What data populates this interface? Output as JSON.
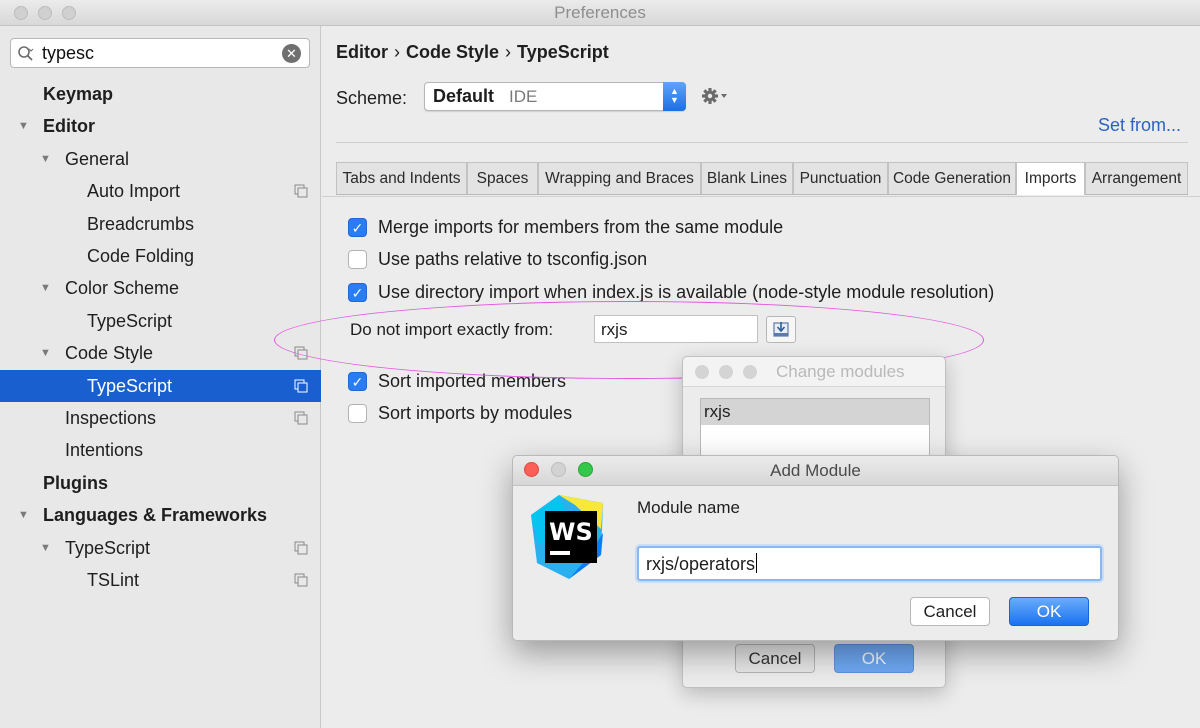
{
  "window": {
    "title": "Preferences"
  },
  "sidebar": {
    "search_value": "typesc",
    "items": [
      {
        "label": "Keymap",
        "level": 0,
        "expandable": false,
        "bold": true,
        "project": false,
        "selected": false
      },
      {
        "label": "Editor",
        "level": 0,
        "expandable": true,
        "bold": true,
        "project": false,
        "selected": false
      },
      {
        "label": "General",
        "level": 1,
        "expandable": true,
        "bold": false,
        "project": false,
        "selected": false
      },
      {
        "label": "Auto Import",
        "level": 2,
        "expandable": false,
        "bold": false,
        "project": true,
        "selected": false
      },
      {
        "label": "Breadcrumbs",
        "level": 2,
        "expandable": false,
        "bold": false,
        "project": false,
        "selected": false
      },
      {
        "label": "Code Folding",
        "level": 2,
        "expandable": false,
        "bold": false,
        "project": false,
        "selected": false
      },
      {
        "label": "Color Scheme",
        "level": 1,
        "expandable": true,
        "bold": false,
        "project": false,
        "selected": false
      },
      {
        "label": "TypeScript",
        "level": 2,
        "expandable": false,
        "bold": false,
        "project": false,
        "selected": false
      },
      {
        "label": "Code Style",
        "level": 1,
        "expandable": true,
        "bold": false,
        "project": true,
        "selected": false
      },
      {
        "label": "TypeScript",
        "level": 2,
        "expandable": false,
        "bold": false,
        "project": true,
        "selected": true
      },
      {
        "label": "Inspections",
        "level": 1,
        "expandable": false,
        "bold": false,
        "project": true,
        "selected": false
      },
      {
        "label": "Intentions",
        "level": 1,
        "expandable": false,
        "bold": false,
        "project": false,
        "selected": false
      },
      {
        "label": "Plugins",
        "level": 0,
        "expandable": false,
        "bold": true,
        "project": false,
        "selected": false
      },
      {
        "label": "Languages & Frameworks",
        "level": 0,
        "expandable": true,
        "bold": true,
        "project": false,
        "selected": false
      },
      {
        "label": "TypeScript",
        "level": 1,
        "expandable": true,
        "bold": false,
        "project": true,
        "selected": false
      },
      {
        "label": "TSLint",
        "level": 2,
        "expandable": false,
        "bold": false,
        "project": true,
        "selected": false
      }
    ]
  },
  "main": {
    "breadcrumb": [
      "Editor",
      "Code Style",
      "TypeScript"
    ],
    "breadcrumb_separator": "›",
    "scheme_label": "Scheme:",
    "scheme_name": "Default",
    "scheme_type": "IDE",
    "set_from": "Set from...",
    "tabs": [
      "Tabs and Indents",
      "Spaces",
      "Wrapping and Braces",
      "Blank Lines",
      "Punctuation",
      "Code Generation",
      "Imports",
      "Arrangement"
    ],
    "active_tab": "Imports",
    "options": [
      {
        "label": "Merge imports for members from the same module",
        "checked": true
      },
      {
        "label": "Use paths relative to tsconfig.json",
        "checked": false
      },
      {
        "label": "Use directory import when index.js is available (node-style module resolution)",
        "checked": true
      },
      {
        "label": "Sort imported members",
        "checked": true
      },
      {
        "label": "Sort imports by modules",
        "checked": false
      }
    ],
    "do_not_import_label": "Do not import exactly from:",
    "do_not_import_value": "rxjs"
  },
  "change_modules_dialog": {
    "title": "Change modules",
    "items": [
      "rxjs"
    ],
    "cancel_label": "Cancel",
    "ok_label": "OK"
  },
  "add_module_dialog": {
    "title": "Add Module",
    "field_label": "Module name",
    "field_value": "rxjs/operators",
    "logo_text": "WS",
    "cancel_label": "Cancel",
    "ok_label": "OK"
  },
  "colors": {
    "selection": "#1a5fd0",
    "checkbox_checked": "#2a7cf6",
    "link": "#2d62c4",
    "annotation_ellipse": "#e155df"
  }
}
